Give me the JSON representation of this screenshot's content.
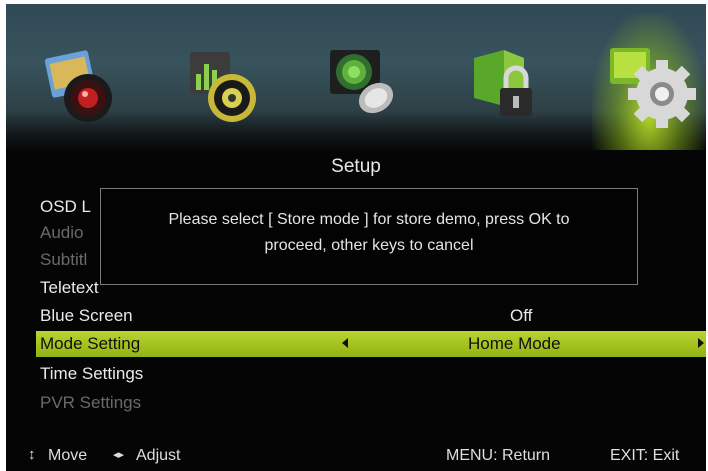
{
  "menu_icons": [
    {
      "name": "picture-icon"
    },
    {
      "name": "sound-icon"
    },
    {
      "name": "channel-icon"
    },
    {
      "name": "lock-icon"
    },
    {
      "name": "setup-icon",
      "selected": true
    }
  ],
  "title": "Setup",
  "menu_items": [
    {
      "label": "OSD L",
      "value": "",
      "state": "normal"
    },
    {
      "label": "Audio",
      "value": "",
      "state": "dim"
    },
    {
      "label": "Subtitl",
      "value": "",
      "state": "dim"
    },
    {
      "label": "Teletext",
      "value": "",
      "state": "normal"
    },
    {
      "label": "Blue Screen",
      "value": "Off",
      "state": "normal"
    },
    {
      "label": "Mode Setting",
      "value": "Home Mode",
      "state": "active"
    },
    {
      "label": "Time Settings",
      "value": "",
      "state": "normal"
    },
    {
      "label": "PVR Settings",
      "value": "",
      "state": "dim"
    }
  ],
  "dialog": {
    "line1": "Please select [ Store mode ] for store demo, press OK to",
    "line2": "proceed, other keys to cancel"
  },
  "footer": {
    "move": "Move",
    "adjust": "Adjust",
    "menu": "MENU: Return",
    "exit": "EXIT: Exit"
  },
  "colors": {
    "highlight": "#a8c828",
    "background": "#050505",
    "text": "#eaeaea"
  }
}
